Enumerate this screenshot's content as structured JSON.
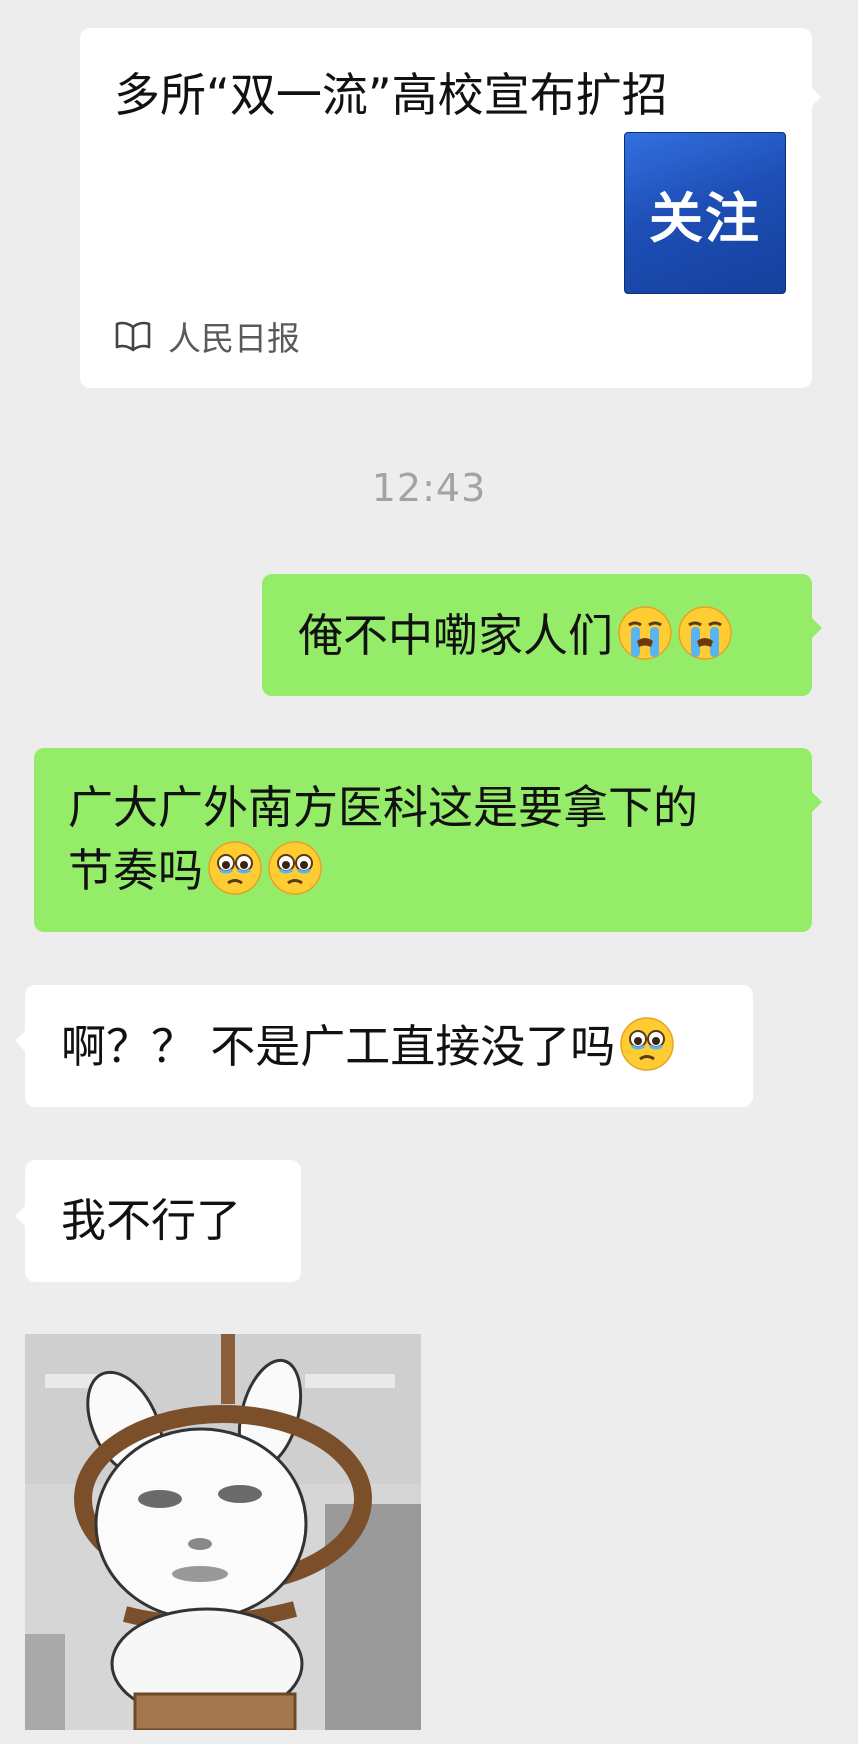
{
  "article": {
    "title": "多所“双一流”高校宣布扩招",
    "thumbnail_text": "关注",
    "source": "人民日报",
    "source_icon": "book-open-icon"
  },
  "timestamp": "12:43",
  "messages": [
    {
      "side": "right",
      "text": "俺不中嘞家人们",
      "emoji": [
        "loudly-crying-emoji",
        "loudly-crying-emoji"
      ]
    },
    {
      "side": "right",
      "line1": "广大广外南方医科这是要拿下的",
      "line2": "节奏吗",
      "emoji": [
        "holding-back-tears-emoji",
        "holding-back-tears-emoji"
      ]
    },
    {
      "side": "left",
      "text": "啊？？ 不是广工直接没了吗",
      "emoji": [
        "holding-back-tears-emoji"
      ]
    },
    {
      "side": "left",
      "text": "我不行了"
    },
    {
      "side": "left",
      "sticker": "rabbit-noose-sticker"
    }
  ],
  "colors": {
    "background": "#ededed",
    "sent_bubble": "#95ec69",
    "received_bubble": "#ffffff",
    "timestamp": "#a3a3a3",
    "thumbnail_blue": "#1e4fb6"
  }
}
